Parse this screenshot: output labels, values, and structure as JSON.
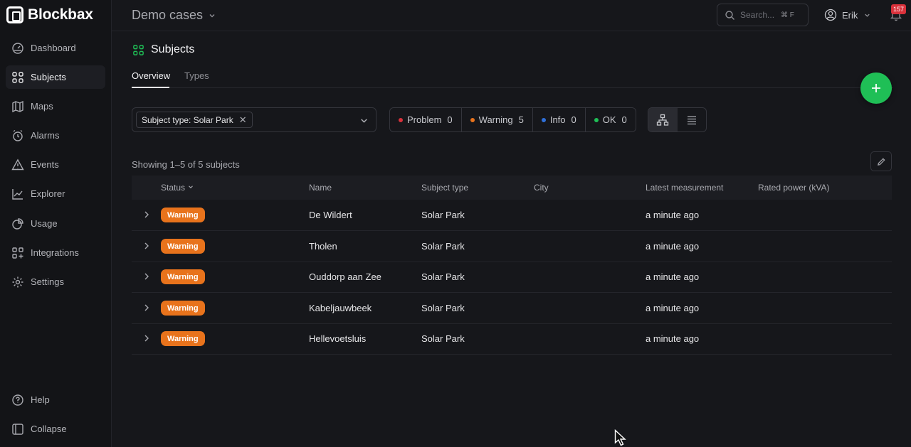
{
  "app": {
    "brand": "Blockbax",
    "workspace": "Demo cases"
  },
  "search": {
    "placeholder": "Search...",
    "shortcut": "⌘ F"
  },
  "user": {
    "name": "Erik",
    "notifications": "157"
  },
  "sidebar": {
    "items": [
      {
        "label": "Dashboard",
        "icon": "gauge-icon"
      },
      {
        "label": "Subjects",
        "icon": "grid-icon",
        "active": true
      },
      {
        "label": "Maps",
        "icon": "map-icon"
      },
      {
        "label": "Alarms",
        "icon": "alarm-icon"
      },
      {
        "label": "Events",
        "icon": "warning-triangle-icon"
      },
      {
        "label": "Explorer",
        "icon": "chart-line-icon"
      },
      {
        "label": "Usage",
        "icon": "pie-icon"
      },
      {
        "label": "Integrations",
        "icon": "grid-plus-icon"
      },
      {
        "label": "Settings",
        "icon": "gear-icon"
      }
    ],
    "footer": [
      {
        "label": "Help",
        "icon": "help-icon"
      },
      {
        "label": "Collapse",
        "icon": "collapse-icon"
      }
    ]
  },
  "page": {
    "title": "Subjects",
    "tabs": [
      "Overview",
      "Types"
    ],
    "filter_chip": "Subject type: Solar Park",
    "status_filters": [
      {
        "label": "Problem",
        "count": "0",
        "color": "#d8313b"
      },
      {
        "label": "Warning",
        "count": "5",
        "color": "#e8731c"
      },
      {
        "label": "Info",
        "count": "0",
        "color": "#2f6fd8"
      },
      {
        "label": "OK",
        "count": "0",
        "color": "#1fbf56"
      }
    ],
    "showing": "Showing 1–5 of 5 subjects"
  },
  "table": {
    "columns": [
      "Status",
      "Name",
      "Subject type",
      "City",
      "Latest measurement",
      "Rated power (kVA)"
    ],
    "rows": [
      {
        "status": "Warning",
        "name": "De Wildert",
        "type": "Solar Park",
        "city": "",
        "latest": "a minute ago",
        "power": ""
      },
      {
        "status": "Warning",
        "name": "Tholen",
        "type": "Solar Park",
        "city": "",
        "latest": "a minute ago",
        "power": ""
      },
      {
        "status": "Warning",
        "name": "Ouddorp aan Zee",
        "type": "Solar Park",
        "city": "",
        "latest": "a minute ago",
        "power": ""
      },
      {
        "status": "Warning",
        "name": "Kabeljauwbeek",
        "type": "Solar Park",
        "city": "",
        "latest": "a minute ago",
        "power": ""
      },
      {
        "status": "Warning",
        "name": "Hellevoetsluis",
        "type": "Solar Park",
        "city": "",
        "latest": "a minute ago",
        "power": ""
      }
    ]
  },
  "colors": {
    "accent_green": "#1fbf56",
    "warning": "#e8731c",
    "badge_red": "#d8313b"
  }
}
